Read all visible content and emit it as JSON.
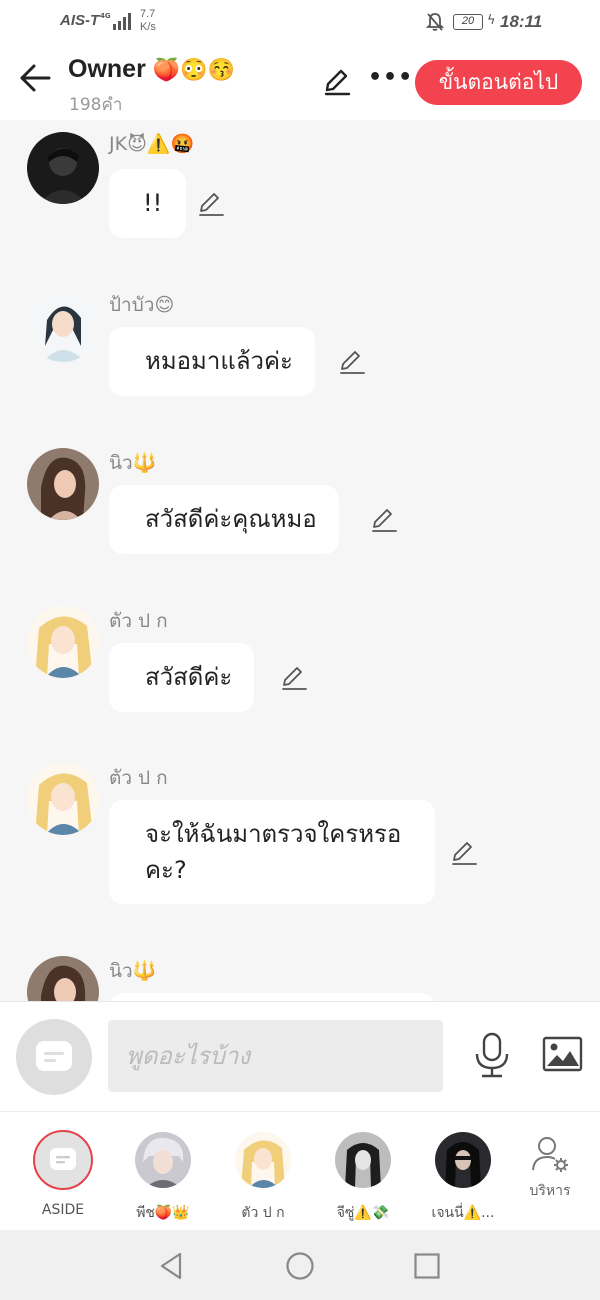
{
  "status_bar": {
    "carrier": "AIS-T",
    "network": "4G",
    "speed_value": "7.7",
    "speed_unit": "K/s",
    "battery": "20",
    "time": "18:11"
  },
  "header": {
    "title": "Owner",
    "title_emoji": "🍑😳😚",
    "subtitle": "198คำ",
    "next_button": "ขั้นตอนต่อไป"
  },
  "messages": [
    {
      "name": "JK😈⚠️🤬",
      "text": "!!"
    },
    {
      "name": "ป้าบัว😊",
      "text": "หมอมาแล้วค่ะ"
    },
    {
      "name": "นิว🔱",
      "text": "สวัสดีค่ะคุณหมอ"
    },
    {
      "name": "ตัว ป ก",
      "text": "สวัสดีค่ะ"
    },
    {
      "name": "ตัว ป ก",
      "text": "จะให้ฉันมาตรวจใครหรอคะ?"
    },
    {
      "name": "นิว🔱",
      "text": ""
    }
  ],
  "composer": {
    "placeholder": "พูดอะไรบ้าง"
  },
  "characters": [
    {
      "label": "ASIDE"
    },
    {
      "label": "พีช🍑👑"
    },
    {
      "label": "ตัว ป ก"
    },
    {
      "label": "จีซู่⚠️💸"
    },
    {
      "label": "เจนนี่⚠️..."
    }
  ],
  "manage_label": "บริหาร",
  "colors": {
    "accent": "#f2434e",
    "background": "#f6f6f6",
    "bubble": "#ffffff"
  }
}
